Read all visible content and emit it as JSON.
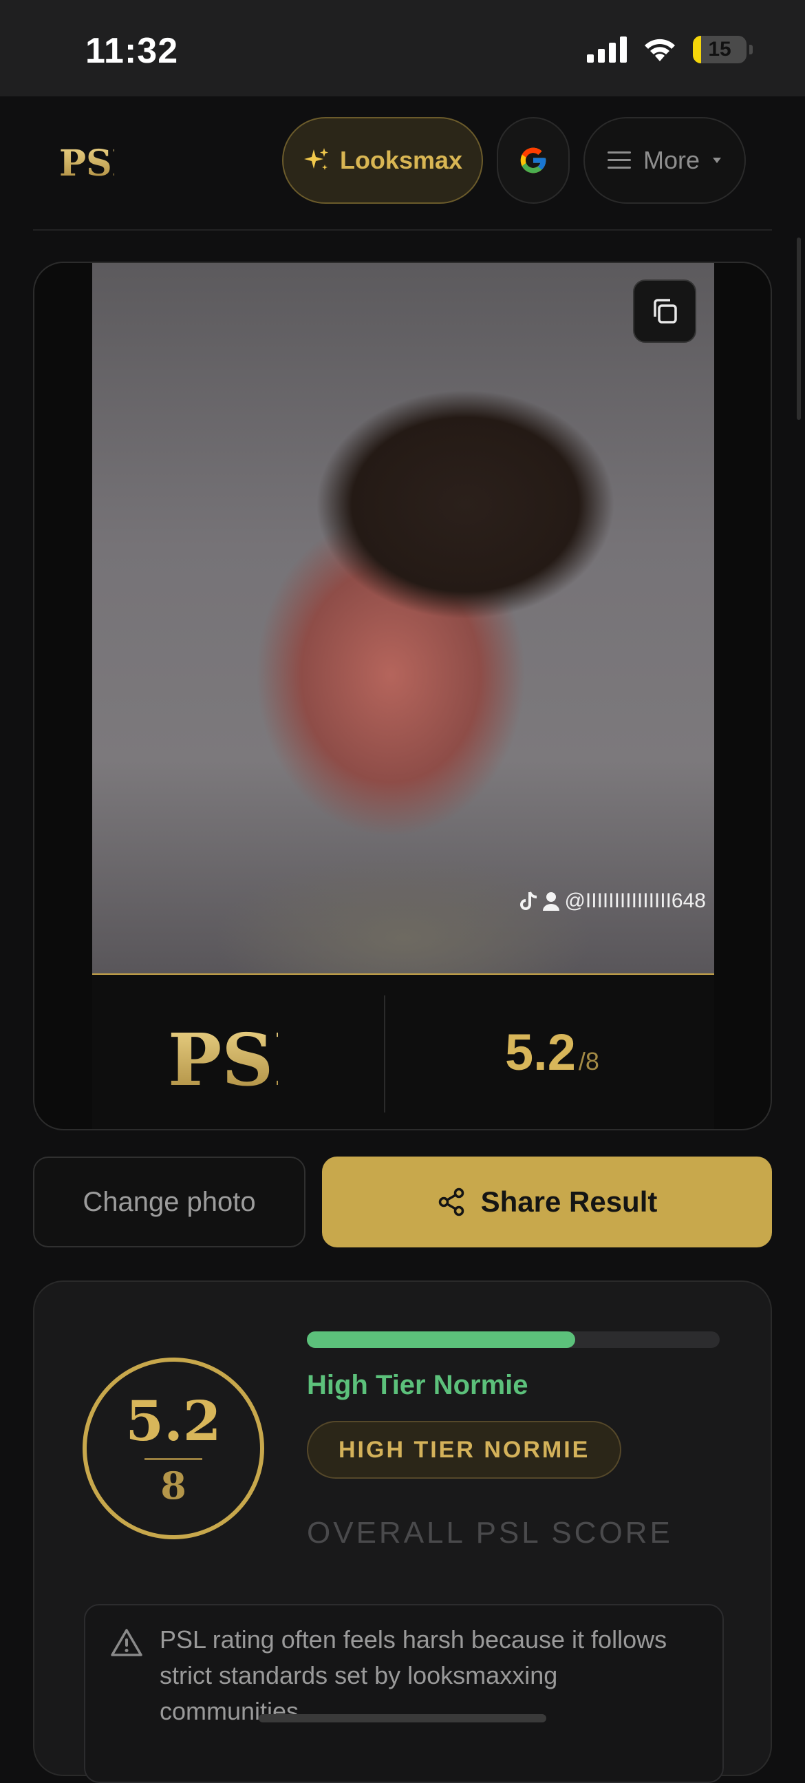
{
  "status_bar": {
    "time": "11:32",
    "battery": "15",
    "battery_fraction": 0.15
  },
  "header": {
    "logo_text": "PSL",
    "looksmax_label": "Looksmax",
    "looksmax_icon": "sparkles-icon",
    "google_icon": "google-g-icon",
    "more_label": "More"
  },
  "photo_card": {
    "watermark": "@IIIIIIIIIIIIIII648",
    "logo_text": "PSL",
    "score": "5.2",
    "score_max": "/8"
  },
  "actions": {
    "change_photo": "Change photo",
    "share_result": "Share Result"
  },
  "result": {
    "score": "5.2",
    "score_max": "8",
    "progress_fraction": 0.65,
    "tier_text": "High Tier Normie",
    "tier_badge": "HIGH TIER NORMIE",
    "overall_label": "OVERALL PSL SCORE",
    "warning": "PSL rating often feels harsh because it follows strict standards set by looksmaxxing communities."
  },
  "colors": {
    "accent_gold": "#c8a84c",
    "tier_green": "#5cc17b",
    "background": "#0f0f10"
  }
}
